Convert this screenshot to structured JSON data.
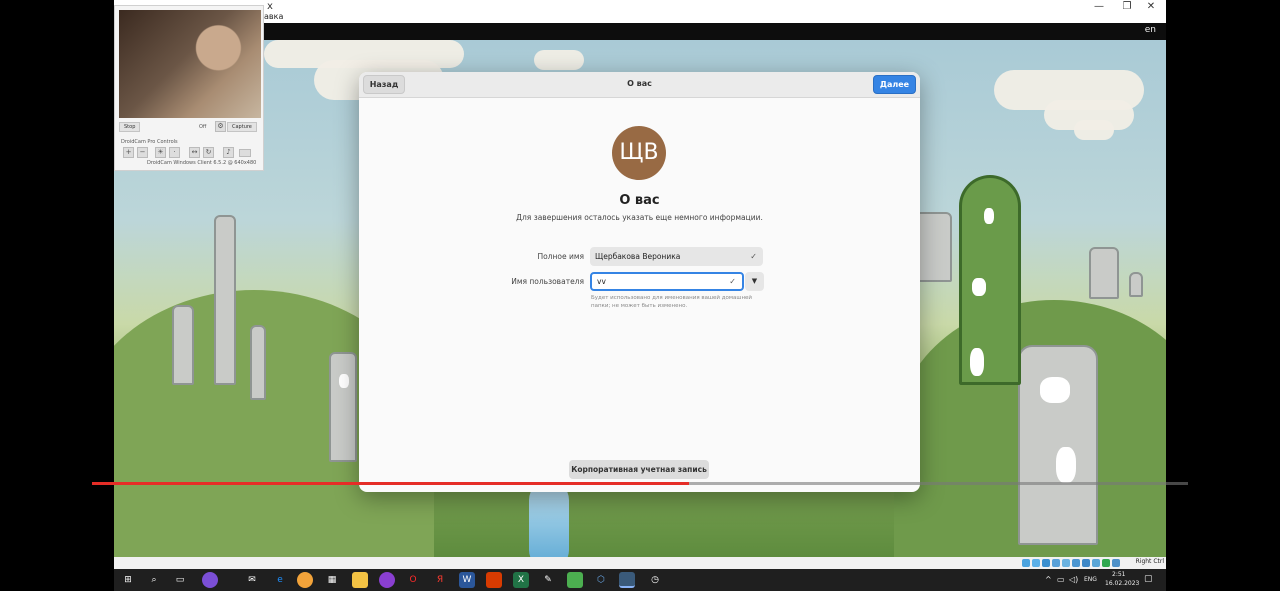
{
  "host": {
    "menu_fragment": "авка",
    "win_close": "✕",
    "win_maximize": "❐",
    "win_minimize": "—",
    "x_fragment": "x"
  },
  "vm_topbar": {
    "lang": "en"
  },
  "webcam": {
    "stop_label": "Stop",
    "off_label": "Off",
    "capture_label": "Capture",
    "title": "DroidCam Pro Controls",
    "footer": "DroidCam Windows Client 6.5.2 @ 640x480"
  },
  "dialog": {
    "back_label": "Назад",
    "next_label": "Далее",
    "header_title": "О вас",
    "avatar_initials": "ЩВ",
    "title": "О вас",
    "subtitle": "Для завершения осталось указать еще немного информации.",
    "fullname_label": "Полное имя",
    "fullname_value": "Щербакова Вероника",
    "username_label": "Имя пользователя",
    "username_value": "vv",
    "hint": "Будет использовано для именования вашей домашней папки; не может быть изменено.",
    "enterprise_label": "Корпоративная учетная запись",
    "check_glyph": "✓",
    "dropdown_glyph": "▼"
  },
  "video_progress": {
    "fraction": 0.545
  },
  "vbox_statusbar": {
    "host_key": "Right Ctrl"
  },
  "taskbar": {
    "lang": "ENG",
    "time": "2:51",
    "date": "16.02.2023"
  },
  "colors": {
    "accent": "#3584e4",
    "avatar": "#986a44",
    "progress": "#e52d27"
  }
}
